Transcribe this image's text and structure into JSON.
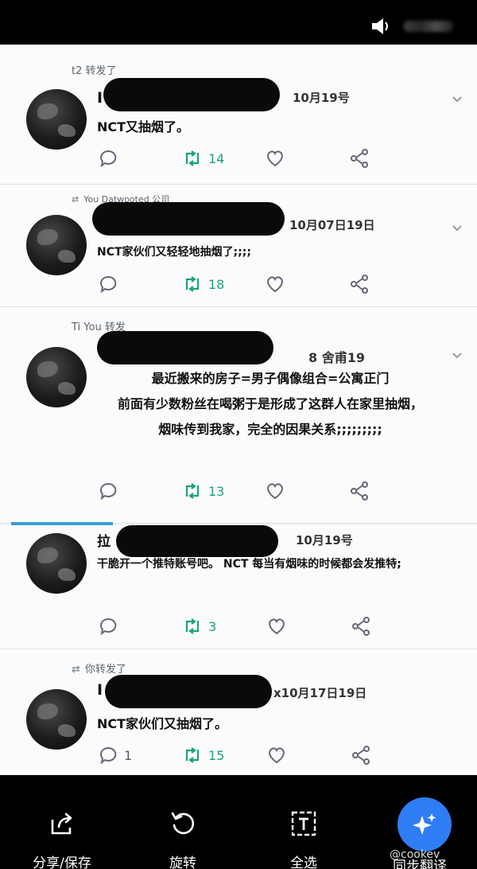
{
  "topbar": {
    "icon": "speaker-icon",
    "blurred_text": ""
  },
  "tweets": [
    {
      "retweet_label": "t2 转发了",
      "initial": "I",
      "date": "10月19号",
      "text": "NCT又抽烟了。",
      "retweets": "14",
      "replies": "",
      "icons": [
        "reply-icon",
        "retweet-icon",
        "like-icon",
        "share-icon"
      ]
    },
    {
      "retweet_label": "You Datwooted 公司",
      "initial": "",
      "date": "10月07日19日",
      "text": "NCT家伙们又轻轻地抽烟了;;;;",
      "retweets": "18",
      "replies": ""
    },
    {
      "retweet_label": "Ti You 转发",
      "initial": "",
      "date": "8 舍甫19",
      "lines": [
        "最近搬来的房子=男子偶像组合=公寓正门",
        "前面有少数粉丝在喝粥于是形成了这群人在家里抽烟，",
        "烟味传到我家，完全的因果关系;;;;;;;;;"
      ],
      "retweets": "13",
      "replies": ""
    },
    {
      "retweet_label": "",
      "initial": "拉",
      "date": "10月19号",
      "text": "干脆开一个推特账号吧。 NCT 每当有烟味的时候都会发推特;",
      "retweets": "3",
      "replies": ""
    },
    {
      "retweet_label": "你转发了",
      "initial": "I",
      "date": "x10月17日19日",
      "text": "NCT家伙们又抽烟了。",
      "retweets": "15",
      "replies": "1"
    }
  ],
  "bottom_bar": {
    "share_save": "分享/保存",
    "rotate": "旋转",
    "select_all": "全选",
    "translate": "同步翻译"
  },
  "watermark": "@cookev",
  "colors": {
    "retweet_green": "#1aa37a",
    "fab_blue": "#2f7df4"
  }
}
